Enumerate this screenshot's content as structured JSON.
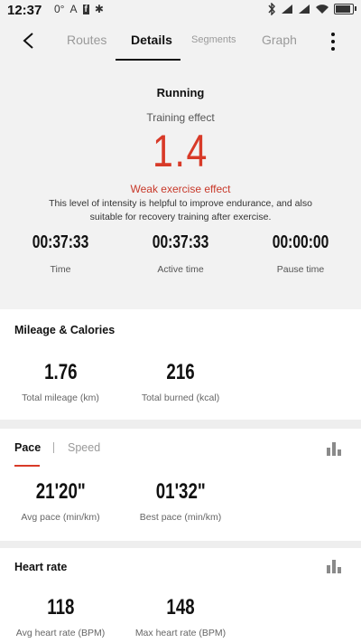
{
  "status": {
    "time": "12:37",
    "signal_small": "0°",
    "left_glyphs": [
      "A",
      "f",
      "✱"
    ]
  },
  "header": {
    "tabs": [
      {
        "label": "Routes"
      },
      {
        "label": "Details"
      },
      {
        "label": "Segments"
      },
      {
        "label": "Graph"
      }
    ],
    "active_tab": "Details"
  },
  "summary": {
    "activity": "Running",
    "training_effect_label": "Training effect",
    "training_effect_value": "1.4",
    "effect_title": "Weak exercise effect",
    "effect_description": "This level of intensity is helpful to improve endurance, and also suitable for recovery training after exercise.",
    "stats": [
      {
        "value": "00:37:33",
        "label": "Time"
      },
      {
        "value": "00:37:33",
        "label": "Active time"
      },
      {
        "value": "00:00:00",
        "label": "Pause time"
      }
    ]
  },
  "mileage": {
    "title": "Mileage & Calories",
    "stats": [
      {
        "value": "1.76",
        "label": "Total mileage (km)"
      },
      {
        "value": "216",
        "label": "Total burned (kcal)"
      }
    ]
  },
  "pace": {
    "tabs": [
      {
        "label": "Pace"
      },
      {
        "label": "Speed"
      }
    ],
    "active_tab": "Pace",
    "stats": [
      {
        "value": "21'20\"",
        "label": "Avg pace (min/km)"
      },
      {
        "value": "01'32\"",
        "label": "Best pace (min/km)"
      }
    ]
  },
  "heart_rate": {
    "title": "Heart rate",
    "stats": [
      {
        "value": "118",
        "label": "Avg heart rate (BPM)"
      },
      {
        "value": "148",
        "label": "Max heart rate (BPM)"
      }
    ]
  },
  "colors": {
    "accent": "#d83a28",
    "background": "#f2f2f2"
  }
}
